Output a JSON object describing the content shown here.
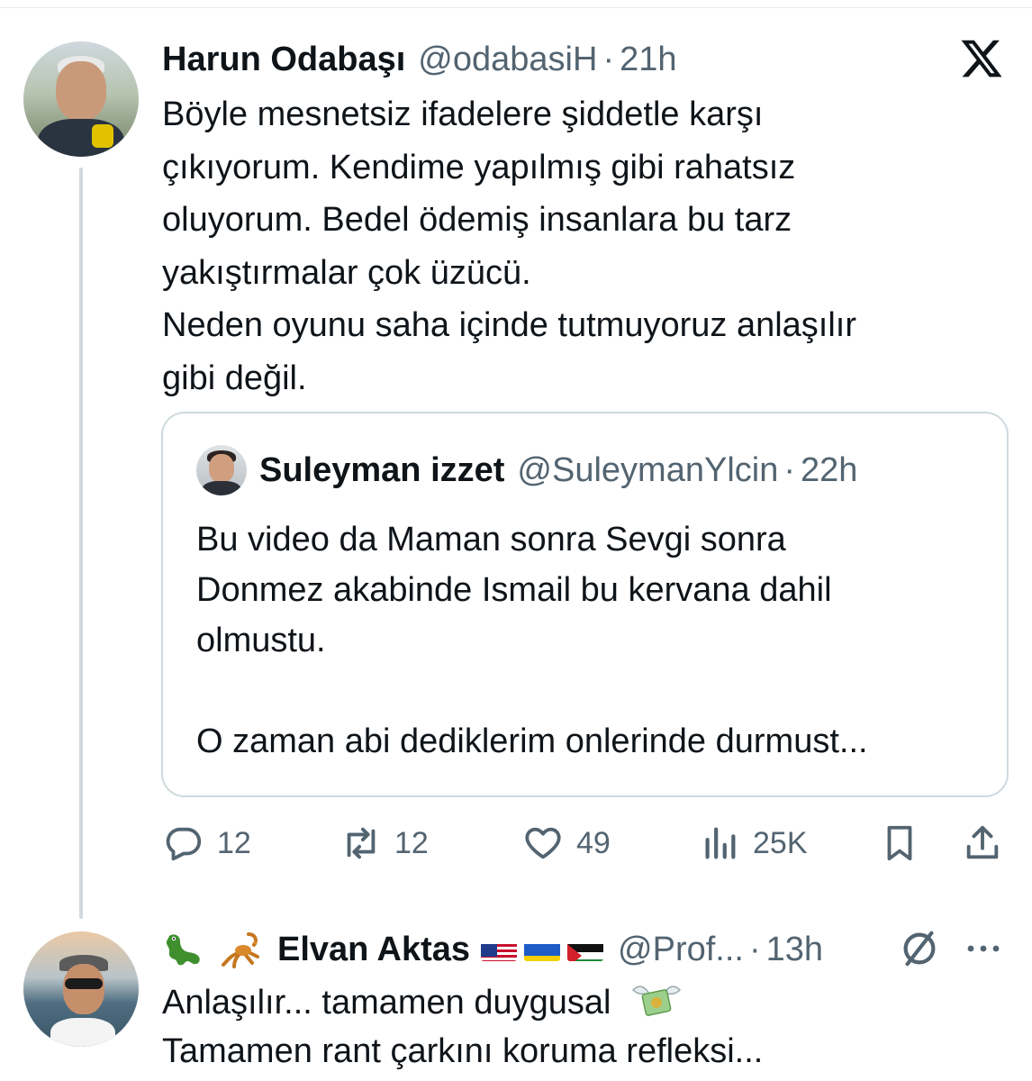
{
  "tweet": {
    "author_name": "Harun Odabaşı",
    "author_handle": "@odabasiH",
    "time": "21h",
    "text_lines": [
      "Böyle mesnetsiz ifadelere şiddetle karşı",
      "çıkıyorum. Kendime yapılmış gibi rahatsız",
      "oluyorum. Bedel ödemiş insanlara bu tarz",
      "yakıştırmalar çok üzücü.",
      "Neden oyunu saha içinde tutmuyoruz anlaşılır",
      "gibi değil."
    ]
  },
  "quote": {
    "author_name": "Suleyman izzet",
    "author_handle": "@SuleymanYlcin",
    "time": "22h",
    "text_lines": [
      "Bu video da Maman sonra Sevgi sonra",
      "Donmez akabinde Ismail bu kervana dahil",
      "olmustu.",
      "",
      "O zaman abi dediklerim onlerinde durmust..."
    ]
  },
  "actions": {
    "replies": "12",
    "reposts": "12",
    "likes": "49",
    "views": "25K"
  },
  "reply": {
    "author_name": "Elvan Aktas",
    "name_prefix_icons": [
      "crocodile-emoji",
      "scorpion-emoji"
    ],
    "flags": [
      "us-flag",
      "ukraine-flag",
      "palestine-flag"
    ],
    "author_handle": "@Prof...",
    "time": "13h",
    "text_lines": [
      "Anlaşılır... tamamen duygusal",
      "Tamamen rant çarkını koruma refleksi..."
    ]
  },
  "separator": "·",
  "colors": {
    "text": "#0f1419",
    "secondary": "#536471",
    "border": "#cfd9de"
  }
}
